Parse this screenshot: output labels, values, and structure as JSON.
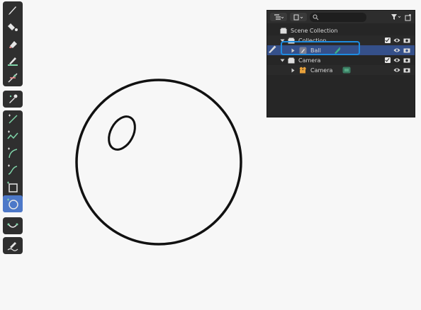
{
  "outliner": {
    "search_placeholder": "",
    "rows": [
      {
        "label": "Scene Collection"
      },
      {
        "label": "Collection"
      },
      {
        "label": "Ball"
      },
      {
        "label": "Camera"
      },
      {
        "label": "Camera"
      }
    ]
  },
  "colors": {
    "accent": "#4d78c8",
    "highlight": "#1e8be0",
    "toolbar_bg": "#2f2f2f",
    "outliner_bg": "#262626",
    "stroke": "#111111"
  },
  "icons": {
    "toolbar": [
      "draw-brush-icon",
      "fill-bucket-icon",
      "eraser-icon",
      "tint-icon",
      "cutter-icon",
      "eyedropper-icon",
      "line-tool-icon",
      "polyline-tool-icon",
      "arc-tool-icon",
      "curve-tool-icon",
      "box-tool-icon",
      "circle-tool-icon",
      "interpolate-icon",
      "annotate-icon"
    ]
  }
}
